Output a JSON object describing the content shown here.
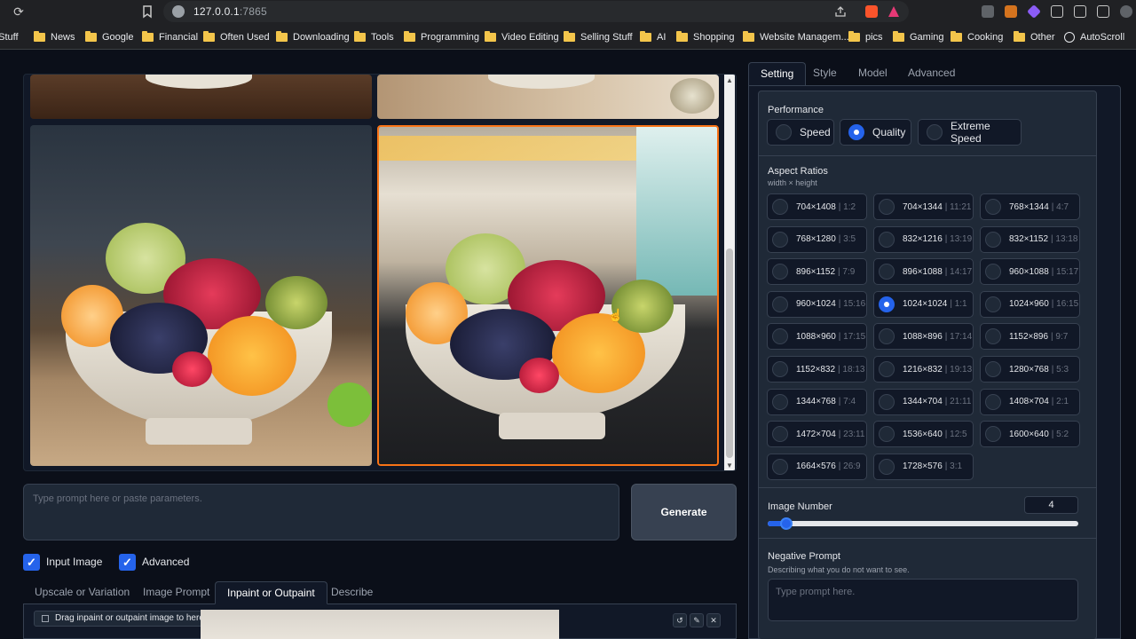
{
  "browser": {
    "url_host": "127.0.0.1",
    "url_port": ":7865"
  },
  "bookmarks": [
    {
      "label": "t Stuff",
      "type": "folder"
    },
    {
      "label": "News",
      "type": "folder"
    },
    {
      "label": "Google",
      "type": "folder"
    },
    {
      "label": "Financial",
      "type": "folder"
    },
    {
      "label": "Often Used",
      "type": "folder"
    },
    {
      "label": "Downloading",
      "type": "folder"
    },
    {
      "label": "Tools",
      "type": "folder"
    },
    {
      "label": "Programming",
      "type": "folder"
    },
    {
      "label": "Video Editing",
      "type": "folder"
    },
    {
      "label": "Selling Stuff",
      "type": "folder"
    },
    {
      "label": "AI",
      "type": "folder"
    },
    {
      "label": "Shopping",
      "type": "folder"
    },
    {
      "label": "Website Managem...",
      "type": "folder"
    },
    {
      "label": "pics",
      "type": "folder"
    },
    {
      "label": "Gaming",
      "type": "folder"
    },
    {
      "label": "Cooking",
      "type": "folder"
    },
    {
      "label": "Other",
      "type": "folder"
    },
    {
      "label": "AutoScroll",
      "type": "globe"
    }
  ],
  "prompt": {
    "placeholder": "Type prompt here or paste parameters.",
    "generate_label": "Generate"
  },
  "checkboxes": {
    "input_image": {
      "label": "Input Image",
      "checked": true
    },
    "advanced": {
      "label": "Advanced",
      "checked": true
    }
  },
  "input_tabs": [
    {
      "label": "Upscale or Variation",
      "active": false
    },
    {
      "label": "Image Prompt",
      "active": false
    },
    {
      "label": "Inpaint or Outpaint",
      "active": true
    },
    {
      "label": "Describe",
      "active": false
    }
  ],
  "inpaint": {
    "drag_label": "Drag inpaint or outpaint image to here"
  },
  "settings_tabs": [
    {
      "label": "Setting",
      "active": true
    },
    {
      "label": "Style",
      "active": false
    },
    {
      "label": "Model",
      "active": false
    },
    {
      "label": "Advanced",
      "active": false
    }
  ],
  "performance": {
    "title": "Performance",
    "options": [
      {
        "label": "Speed",
        "selected": false
      },
      {
        "label": "Quality",
        "selected": true
      },
      {
        "label": "Extreme Speed",
        "selected": false
      }
    ]
  },
  "aspect_ratios": {
    "title": "Aspect Ratios",
    "subtitle": "width × height",
    "options": [
      {
        "size": "704×1408",
        "ratio": "1:2",
        "selected": false
      },
      {
        "size": "704×1344",
        "ratio": "11:21",
        "selected": false
      },
      {
        "size": "768×1344",
        "ratio": "4:7",
        "selected": false
      },
      {
        "size": "768×1280",
        "ratio": "3:5",
        "selected": false
      },
      {
        "size": "832×1216",
        "ratio": "13:19",
        "selected": false
      },
      {
        "size": "832×1152",
        "ratio": "13:18",
        "selected": false
      },
      {
        "size": "896×1152",
        "ratio": "7:9",
        "selected": false
      },
      {
        "size": "896×1088",
        "ratio": "14:17",
        "selected": false
      },
      {
        "size": "960×1088",
        "ratio": "15:17",
        "selected": false
      },
      {
        "size": "960×1024",
        "ratio": "15:16",
        "selected": false
      },
      {
        "size": "1024×1024",
        "ratio": "1:1",
        "selected": true
      },
      {
        "size": "1024×960",
        "ratio": "16:15",
        "selected": false
      },
      {
        "size": "1088×960",
        "ratio": "17:15",
        "selected": false
      },
      {
        "size": "1088×896",
        "ratio": "17:14",
        "selected": false
      },
      {
        "size": "1152×896",
        "ratio": "9:7",
        "selected": false
      },
      {
        "size": "1152×832",
        "ratio": "18:13",
        "selected": false
      },
      {
        "size": "1216×832",
        "ratio": "19:13",
        "selected": false
      },
      {
        "size": "1280×768",
        "ratio": "5:3",
        "selected": false
      },
      {
        "size": "1344×768",
        "ratio": "7:4",
        "selected": false
      },
      {
        "size": "1344×704",
        "ratio": "21:11",
        "selected": false
      },
      {
        "size": "1408×704",
        "ratio": "2:1",
        "selected": false
      },
      {
        "size": "1472×704",
        "ratio": "23:11",
        "selected": false
      },
      {
        "size": "1536×640",
        "ratio": "12:5",
        "selected": false
      },
      {
        "size": "1600×640",
        "ratio": "5:2",
        "selected": false
      },
      {
        "size": "1664×576",
        "ratio": "26:9",
        "selected": false
      },
      {
        "size": "1728×576",
        "ratio": "3:1",
        "selected": false
      }
    ]
  },
  "image_number": {
    "title": "Image Number",
    "value": "4",
    "slider_fraction": 0.06
  },
  "negative_prompt": {
    "title": "Negative Prompt",
    "subtitle": "Describing what you do not want to see.",
    "placeholder": "Type prompt here."
  },
  "colors": {
    "accent": "#2563eb",
    "background": "#0b0f19",
    "panel": "#1f2937",
    "selected_border": "#f97316"
  }
}
